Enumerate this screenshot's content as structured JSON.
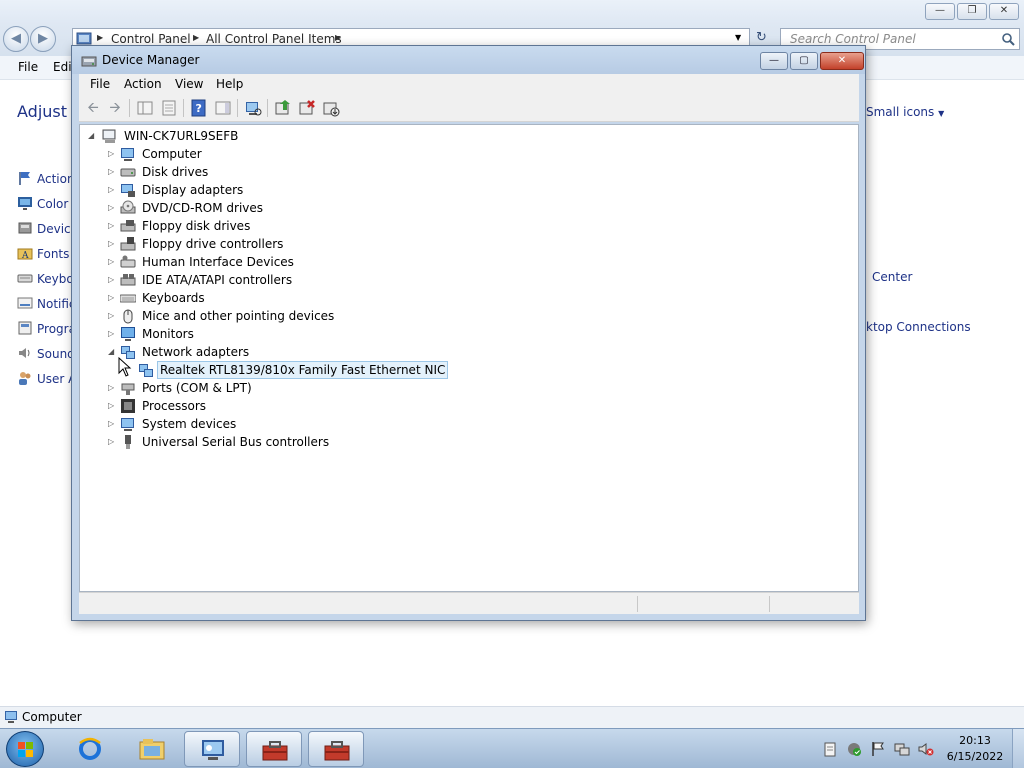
{
  "control_panel": {
    "breadcrumb": [
      "Control Panel",
      "All Control Panel Items"
    ],
    "search_placeholder": "Search Control Panel",
    "menu": [
      "File",
      "Edit"
    ],
    "heading": "Adjust y",
    "view_by": "Small icons",
    "items_left": [
      "Action",
      "Color M",
      "Device",
      "Fonts",
      "Keybo",
      "Notific",
      "Progra",
      "Sound",
      "User A"
    ],
    "items_right": [
      "Center",
      "ktop Connections"
    ],
    "status_text": "Computer"
  },
  "device_manager": {
    "title": "Device Manager",
    "menu": [
      "File",
      "Action",
      "View",
      "Help"
    ],
    "tree": {
      "root": "WIN-CK7URL9SEFB",
      "categories": [
        {
          "label": "Computer",
          "icon": "computer-icon",
          "expanded": false
        },
        {
          "label": "Disk drives",
          "icon": "disk-drive-icon",
          "expanded": false
        },
        {
          "label": "Display adapters",
          "icon": "display-adapter-icon",
          "expanded": false
        },
        {
          "label": "DVD/CD-ROM drives",
          "icon": "dvd-drive-icon",
          "expanded": false
        },
        {
          "label": "Floppy disk drives",
          "icon": "floppy-drive-icon",
          "expanded": false
        },
        {
          "label": "Floppy drive controllers",
          "icon": "floppy-controller-icon",
          "expanded": false
        },
        {
          "label": "Human Interface Devices",
          "icon": "hid-icon",
          "expanded": false
        },
        {
          "label": "IDE ATA/ATAPI controllers",
          "icon": "ide-controller-icon",
          "expanded": false
        },
        {
          "label": "Keyboards",
          "icon": "keyboard-icon",
          "expanded": false
        },
        {
          "label": "Mice and other pointing devices",
          "icon": "mouse-icon",
          "expanded": false
        },
        {
          "label": "Monitors",
          "icon": "monitor-icon",
          "expanded": false
        },
        {
          "label": "Network adapters",
          "icon": "network-adapter-icon",
          "expanded": true,
          "children": [
            "Realtek RTL8139/810x Family Fast Ethernet NIC"
          ]
        },
        {
          "label": "Ports (COM & LPT)",
          "icon": "port-icon",
          "expanded": false
        },
        {
          "label": "Processors",
          "icon": "processor-icon",
          "expanded": false
        },
        {
          "label": "System devices",
          "icon": "system-device-icon",
          "expanded": false
        },
        {
          "label": "Universal Serial Bus controllers",
          "icon": "usb-controller-icon",
          "expanded": false
        }
      ]
    }
  },
  "taskbar": {
    "time": "20:13",
    "date": "6/15/2022"
  }
}
